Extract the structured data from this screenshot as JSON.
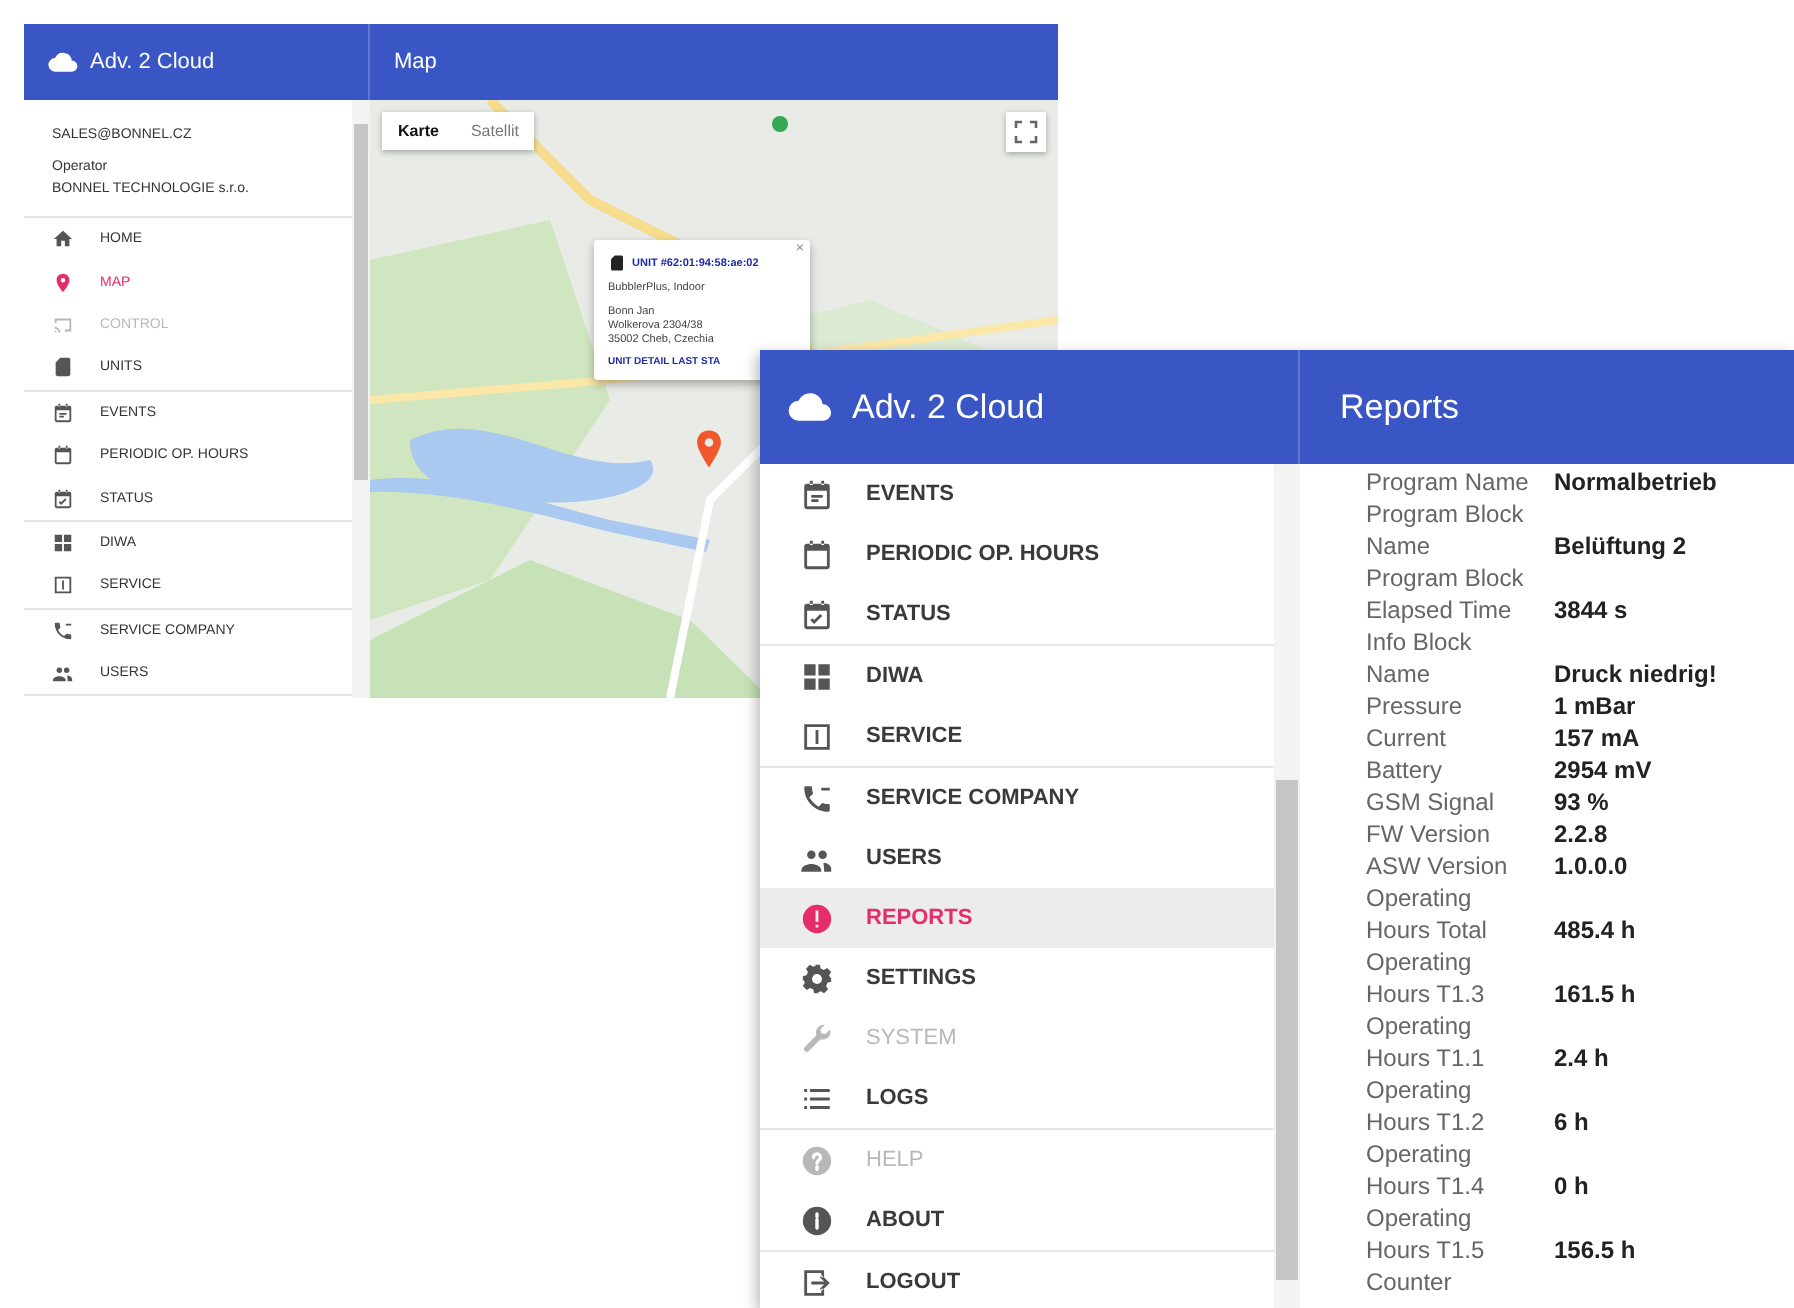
{
  "map_window": {
    "brand": "Adv. 2 Cloud",
    "title": "Map",
    "account": {
      "email": "SALES@BONNEL.CZ",
      "role": "Operator",
      "company": "BONNEL TECHNOLOGIE s.r.o."
    },
    "nav_groups": [
      [
        {
          "label": "HOME",
          "kind": "home",
          "selected": false,
          "disabled": false
        },
        {
          "label": "MAP",
          "kind": "pin",
          "selected": true,
          "disabled": false
        },
        {
          "label": "CONTROL",
          "kind": "cast",
          "selected": false,
          "disabled": true
        },
        {
          "label": "UNITS",
          "kind": "sim",
          "selected": false,
          "disabled": false
        }
      ],
      [
        {
          "label": "EVENTS",
          "kind": "events",
          "selected": false,
          "disabled": false
        },
        {
          "label": "PERIODIC OP. HOURS",
          "kind": "calendar",
          "selected": false,
          "disabled": false
        },
        {
          "label": "STATUS",
          "kind": "status",
          "selected": false,
          "disabled": false
        }
      ],
      [
        {
          "label": "DIWA",
          "kind": "grid",
          "selected": false,
          "disabled": false
        },
        {
          "label": "SERVICE",
          "kind": "service",
          "selected": false,
          "disabled": false
        }
      ],
      [
        {
          "label": "SERVICE COMPANY",
          "kind": "phone",
          "selected": false,
          "disabled": false
        },
        {
          "label": "USERS",
          "kind": "users",
          "selected": false,
          "disabled": false
        }
      ]
    ],
    "map": {
      "kind": "picture",
      "map_types": [
        {
          "label": "Karte",
          "selected": true
        },
        {
          "label": "Satellit",
          "selected": false
        }
      ],
      "popup": {
        "close": "×",
        "title": "UNIT #62:01:94:58:ae:02",
        "subtitle": "BubblerPlus, Indoor",
        "address": [
          "Bonn Jan",
          "Wolkerova 2304/38",
          "35002 Cheb, Czechia"
        ],
        "link": "UNIT DETAIL LAST STA"
      }
    }
  },
  "reports_window": {
    "brand": "Adv. 2 Cloud",
    "title": "Reports",
    "nav_groups": [
      [
        {
          "label": "EVENTS",
          "kind": "events",
          "selected": false,
          "disabled": false
        },
        {
          "label": "PERIODIC OP. HOURS",
          "kind": "calendar",
          "selected": false,
          "disabled": false
        },
        {
          "label": "STATUS",
          "kind": "status",
          "selected": false,
          "disabled": false
        }
      ],
      [
        {
          "label": "DIWA",
          "kind": "grid",
          "selected": false,
          "disabled": false
        },
        {
          "label": "SERVICE",
          "kind": "service",
          "selected": false,
          "disabled": false
        }
      ],
      [
        {
          "label": "SERVICE COMPANY",
          "kind": "phone",
          "selected": false,
          "disabled": false
        },
        {
          "label": "USERS",
          "kind": "users",
          "selected": false,
          "disabled": false
        },
        {
          "label": "REPORTS",
          "kind": "report",
          "selected": true,
          "disabled": false
        },
        {
          "label": "SETTINGS",
          "kind": "gear",
          "selected": false,
          "disabled": false
        },
        {
          "label": "SYSTEM",
          "kind": "wrench",
          "selected": false,
          "disabled": true
        },
        {
          "label": "LOGS",
          "kind": "list",
          "selected": false,
          "disabled": false
        }
      ],
      [
        {
          "label": "HELP",
          "kind": "help",
          "selected": false,
          "disabled": true
        },
        {
          "label": "ABOUT",
          "kind": "about",
          "selected": false,
          "disabled": false
        }
      ],
      [
        {
          "label": "LOGOUT",
          "kind": "logout",
          "selected": false,
          "disabled": false
        }
      ]
    ],
    "report_rows": [
      {
        "label": "Program Name",
        "value": "Normalbetrieb"
      },
      {
        "label": "Program Block Name",
        "value": "Belüftung 2"
      },
      {
        "label": "Program Block Elapsed Time",
        "value": "3844 s"
      },
      {
        "label": "Info Block Name",
        "value": "Druck niedrig!"
      },
      {
        "label": "Pressure",
        "value": "1 mBar"
      },
      {
        "label": "Current",
        "value": "157 mA"
      },
      {
        "label": "Battery",
        "value": "2954 mV"
      },
      {
        "label": "GSM Signal",
        "value": "93 %"
      },
      {
        "label": "FW Version",
        "value": "2.2.8"
      },
      {
        "label": "ASW Version",
        "value": "1.0.0.0"
      },
      {
        "label": "Operating Hours Total",
        "value": "485.4 h"
      },
      {
        "label": "Operating Hours T1.3",
        "value": "161.5 h"
      },
      {
        "label": "Operating Hours T1.1",
        "value": "2.4 h"
      },
      {
        "label": "Operating Hours T1.2",
        "value": "6 h"
      },
      {
        "label": "Operating Hours T1.4",
        "value": "0 h"
      },
      {
        "label": "Operating Hours T1.5",
        "value": "156.5 h"
      },
      {
        "label": "Counter"
      }
    ]
  }
}
